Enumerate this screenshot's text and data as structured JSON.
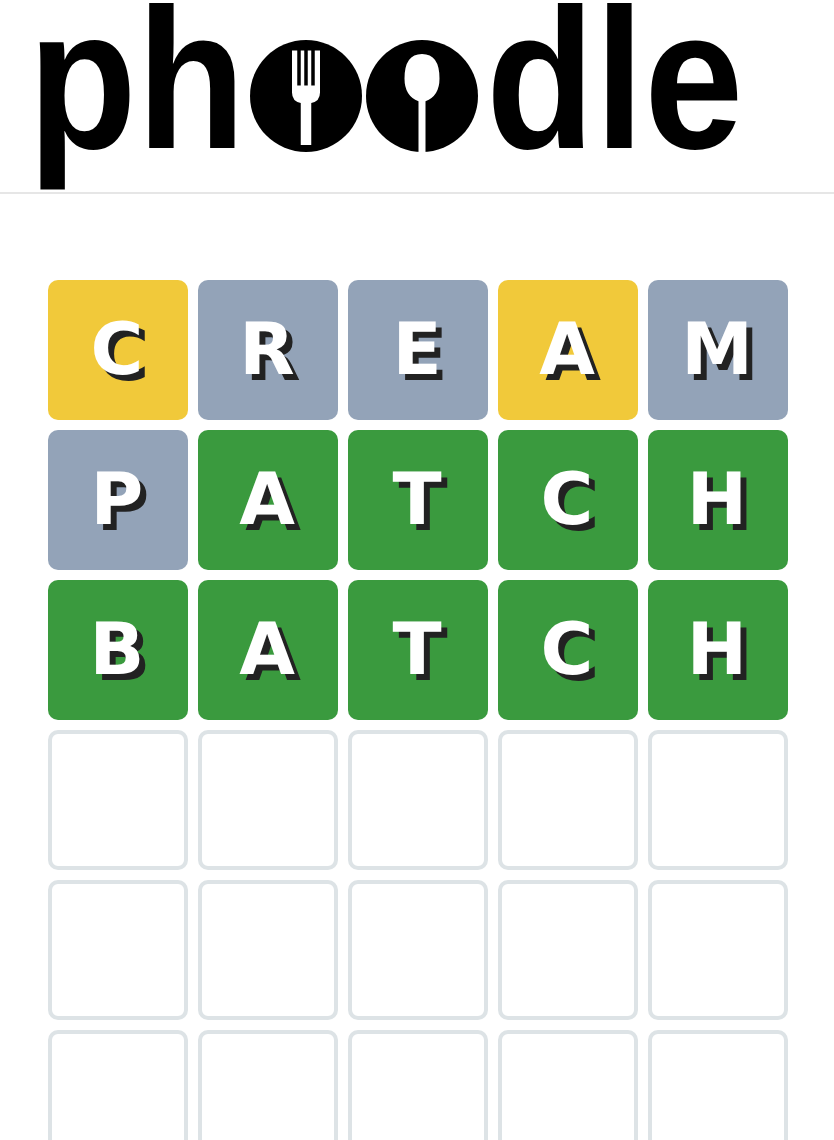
{
  "logo": {
    "start": "ph",
    "end": "dle"
  },
  "board": [
    {
      "tiles": [
        {
          "letter": "C",
          "kind": "present"
        },
        {
          "letter": "R",
          "kind": "absent"
        },
        {
          "letter": "E",
          "kind": "absent"
        },
        {
          "letter": "A",
          "kind": "present"
        },
        {
          "letter": "M",
          "kind": "absent"
        }
      ]
    },
    {
      "tiles": [
        {
          "letter": "P",
          "kind": "absent"
        },
        {
          "letter": "A",
          "kind": "correct"
        },
        {
          "letter": "T",
          "kind": "correct"
        },
        {
          "letter": "C",
          "kind": "correct"
        },
        {
          "letter": "H",
          "kind": "correct"
        }
      ]
    },
    {
      "tiles": [
        {
          "letter": "B",
          "kind": "correct"
        },
        {
          "letter": "A",
          "kind": "correct"
        },
        {
          "letter": "T",
          "kind": "correct"
        },
        {
          "letter": "C",
          "kind": "correct"
        },
        {
          "letter": "H",
          "kind": "correct"
        }
      ]
    },
    {
      "tiles": [
        {
          "kind": "empty"
        },
        {
          "kind": "empty"
        },
        {
          "kind": "empty"
        },
        {
          "kind": "empty"
        },
        {
          "kind": "empty"
        }
      ]
    },
    {
      "tiles": [
        {
          "kind": "empty"
        },
        {
          "kind": "empty"
        },
        {
          "kind": "empty"
        },
        {
          "kind": "empty"
        },
        {
          "kind": "empty"
        }
      ]
    },
    {
      "tiles": [
        {
          "kind": "empty"
        },
        {
          "kind": "empty"
        },
        {
          "kind": "empty"
        },
        {
          "kind": "empty"
        },
        {
          "kind": "empty"
        }
      ]
    }
  ]
}
